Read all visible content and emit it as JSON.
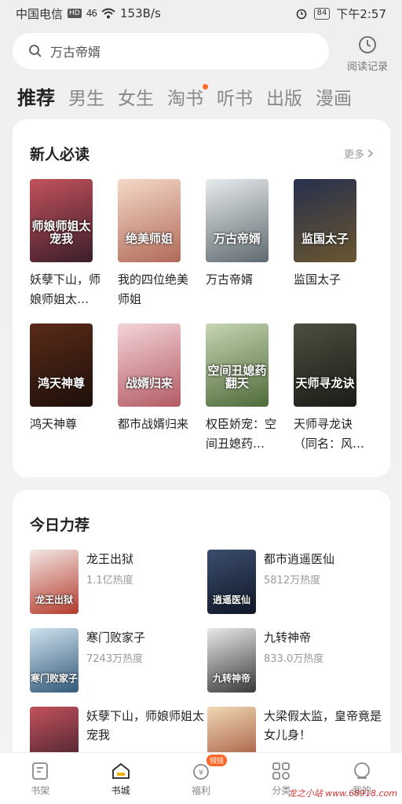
{
  "status_bar": {
    "carrier": "中国电信",
    "hd": "HD",
    "signal": "46",
    "speed": "153B/s",
    "battery": "84",
    "time": "下午2:57"
  },
  "search": {
    "placeholder": "万古帝婿",
    "history_label": "阅读记录"
  },
  "tabs": [
    {
      "label": "推荐",
      "active": true
    },
    {
      "label": "男生"
    },
    {
      "label": "女生"
    },
    {
      "label": "淘书",
      "dot": true
    },
    {
      "label": "听书"
    },
    {
      "label": "出版"
    },
    {
      "label": "漫画"
    }
  ],
  "new_reader": {
    "title": "新人必读",
    "more": "更多",
    "books": [
      {
        "title": "妖孽下山，师娘师姐太…",
        "cover_text": "师娘师姐太宠我",
        "colors": [
          "#c2525c",
          "#3b1e2a"
        ]
      },
      {
        "title": "我的四位绝美师姐",
        "cover_text": "绝美师姐",
        "colors": [
          "#f5d9c9",
          "#b06a58"
        ]
      },
      {
        "title": "万古帝婿",
        "cover_text": "万古帝婿",
        "colors": [
          "#e7ebec",
          "#5f6a70"
        ]
      },
      {
        "title": "监国太子",
        "cover_text": "监国太子",
        "colors": [
          "#27304d",
          "#6a5630"
        ]
      },
      {
        "title": "鸿天神尊",
        "cover_text": "鸿天神尊",
        "colors": [
          "#5a2b18",
          "#1d0f0b"
        ]
      },
      {
        "title": "都市战婿归来",
        "cover_text": "战婿归来",
        "colors": [
          "#f3d5d8",
          "#b35a64"
        ]
      },
      {
        "title": "权臣娇宠：空间丑媳药…",
        "cover_text": "空间丑媳药翻天",
        "colors": [
          "#c6d5b3",
          "#4f6b3a"
        ]
      },
      {
        "title": "天师寻龙诀（同名：风…",
        "cover_text": "天师寻龙诀",
        "colors": [
          "#4c4f3f",
          "#1b1c17"
        ]
      }
    ]
  },
  "today": {
    "title": "今日力荐",
    "items": [
      {
        "title": "龙王出狱",
        "heat": "1.1亿热度",
        "cover_text": "龙王出狱",
        "colors": [
          "#f3e7e5",
          "#b43b2b"
        ]
      },
      {
        "title": "都市逍遥医仙",
        "heat": "5812万热度",
        "cover_text": "逍遥医仙",
        "colors": [
          "#3b4d6e",
          "#101726"
        ]
      },
      {
        "title": "寒门败家子",
        "heat": "7243万热度",
        "cover_text": "寒门败家子",
        "colors": [
          "#cfe2ee",
          "#33597a"
        ]
      },
      {
        "title": "九转神帝",
        "heat": "833.0万热度",
        "cover_text": "九转神帝",
        "colors": [
          "#e9e9e9",
          "#3a3a3a"
        ]
      },
      {
        "title": "妖孽下山，师娘师姐太宠我",
        "heat": "",
        "cover_text": "",
        "colors": [
          "#c2525c",
          "#3b1e2a"
        ]
      },
      {
        "title": "大梁假太监，皇帝竟是女儿身！",
        "heat": "",
        "cover_text": "",
        "colors": [
          "#f0d9b6",
          "#9c4a2f"
        ]
      }
    ]
  },
  "bottom_nav": [
    {
      "label": "书架",
      "icon": "bookshelf-icon"
    },
    {
      "label": "书城",
      "icon": "store-icon",
      "active": true
    },
    {
      "label": "福利",
      "icon": "coin-icon",
      "badge": "领钱"
    },
    {
      "label": "分类",
      "icon": "category-icon"
    },
    {
      "label": "我的",
      "icon": "profile-icon"
    }
  ],
  "watermark": "龙之小站 www.68918.com",
  "accent": "#ff6a2b"
}
